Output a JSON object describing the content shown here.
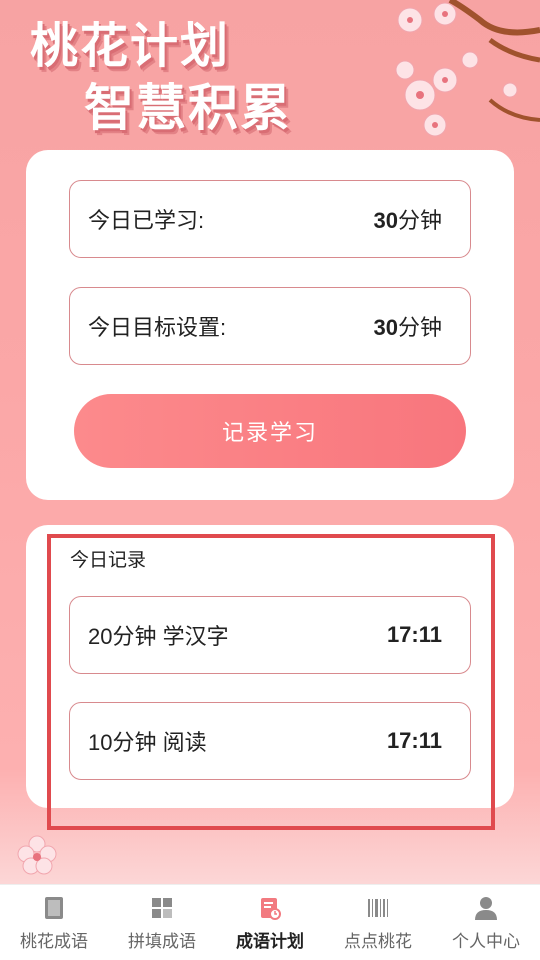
{
  "header": {
    "title_line1": "桃花计划",
    "title_line2": "智慧积累"
  },
  "study_card": {
    "learned_label": "今日已学习:",
    "learned_value": "30",
    "learned_unit": "分钟",
    "goal_label": "今日目标设置:",
    "goal_value": "30",
    "goal_unit": "分钟",
    "record_button": "记录学习"
  },
  "today_records": {
    "title": "今日记录",
    "items": [
      {
        "desc": "20分钟 学汉字",
        "time": "17:11"
      },
      {
        "desc": "10分钟 阅读",
        "time": "17:11"
      }
    ]
  },
  "tabbar": {
    "items": [
      {
        "label": "桃花成语",
        "icon": "book-icon",
        "active": false
      },
      {
        "label": "拼填成语",
        "icon": "grid-icon",
        "active": false
      },
      {
        "label": "成语计划",
        "icon": "plan-clock-icon",
        "active": true
      },
      {
        "label": "点点桃花",
        "icon": "barcode-icon",
        "active": false
      },
      {
        "label": "个人中心",
        "icon": "person-icon",
        "active": false
      }
    ]
  },
  "colors": {
    "background": "#f9a5a5",
    "accent": "#f8767d",
    "highlight": "#e04a4e"
  }
}
